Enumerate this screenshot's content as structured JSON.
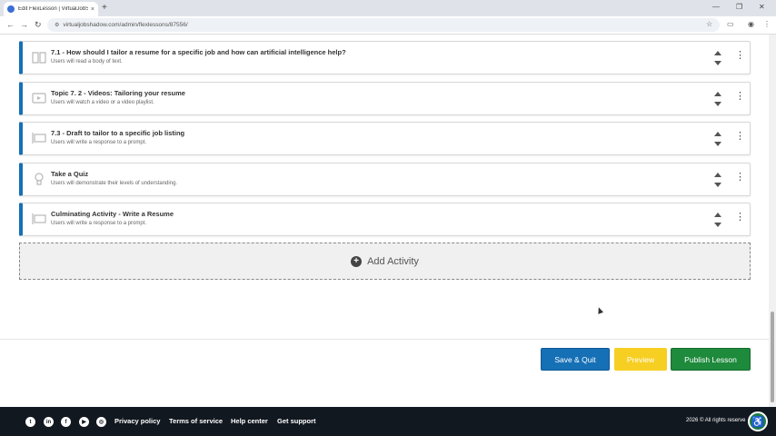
{
  "browser": {
    "tab_title": "Edit FlexLesson | VirtualJobSha",
    "tab_close": "×",
    "new_tab": "+",
    "url": "virtualjobshadow.com/admin/flexlessons/87556/",
    "window_controls": [
      "—",
      "❐",
      "✕"
    ]
  },
  "activities": [
    {
      "title": "7.1 - How should I tailor a resume for a specific job and how can artificial intelligence help?",
      "subtitle": "Users will read a body of text.",
      "icon": "book-icon"
    },
    {
      "title": "Topic 7. 2 - Videos: Tailoring your resume",
      "subtitle": "Users will watch a video or a video playlist.",
      "icon": "video-icon"
    },
    {
      "title": "7.3 - Draft to tailor to a specific job listing",
      "subtitle": "Users will write a response to a prompt.",
      "icon": "prompt-icon"
    },
    {
      "title": "Take a Quiz",
      "subtitle": "Users will demonstrate their levels of understanding.",
      "icon": "lightbulb-icon"
    },
    {
      "title": "Culminating Activity - Write a Resume",
      "subtitle": "Users will write a response to a prompt.",
      "icon": "prompt-icon"
    }
  ],
  "add_activity": {
    "label": "Add Activity",
    "plus": "+"
  },
  "actions": {
    "save_quit": "Save & Quit",
    "preview": "Preview",
    "publish": "Publish Lesson"
  },
  "footer": {
    "social": [
      "twitter-icon",
      "linkedin-icon",
      "facebook-icon",
      "youtube-icon",
      "instagram-icon"
    ],
    "links": [
      "Privacy policy",
      "Terms of service",
      "Help center",
      "Get support"
    ],
    "copyright": "2026 © All rights reserve"
  },
  "colors": {
    "accent": "#1670b6",
    "preview": "#f7cf22",
    "publish": "#1e8a3c",
    "footer": "#121820"
  }
}
